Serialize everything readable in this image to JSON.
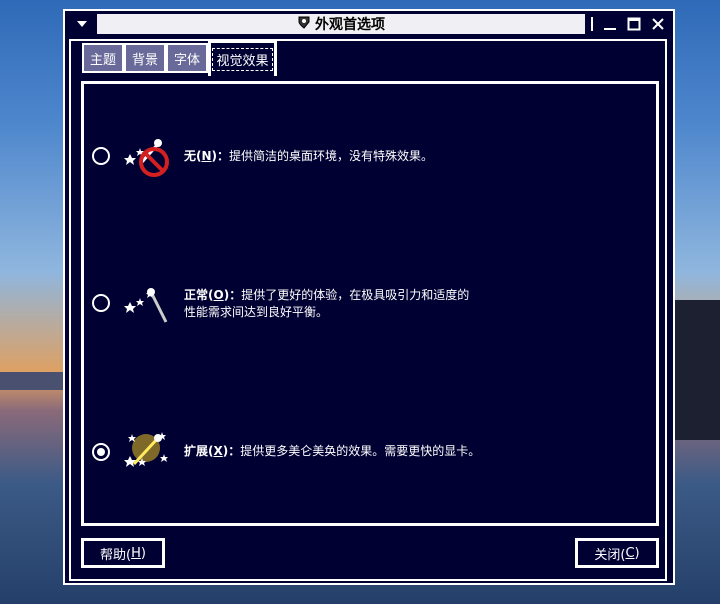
{
  "window": {
    "title": "外观首选项",
    "menu_icon": "triangle-down",
    "controls": [
      "minimize",
      "maximize",
      "close"
    ]
  },
  "tabs": [
    {
      "label": "主题",
      "active": false
    },
    {
      "label": "背景",
      "active": false
    },
    {
      "label": "字体",
      "active": false
    },
    {
      "label": "视觉效果",
      "active": true
    }
  ],
  "options": [
    {
      "name_prefix": "无(",
      "mnemonic": "N",
      "name_suffix": ")：",
      "description": "提供简洁的桌面环境，没有特殊效果。",
      "icon": "no-effects-icon",
      "selected": false
    },
    {
      "name_prefix": "正常(",
      "mnemonic": "O",
      "name_suffix": ")：",
      "description": "提供了更好的体验，在极具吸引力和适度的",
      "description_line2": "性能需求间达到良好平衡。",
      "icon": "normal-effects-icon",
      "selected": false
    },
    {
      "name_prefix": "扩展(",
      "mnemonic": "X",
      "name_suffix": ")：",
      "description": "提供更多美仑美奂的效果。需要更快的显卡。",
      "icon": "extra-effects-icon",
      "selected": true
    }
  ],
  "buttons": {
    "help_prefix": "帮助(",
    "help_mnemonic": "H",
    "help_suffix": ")",
    "close_prefix": "关闭(",
    "close_mnemonic": "C",
    "close_suffix": ")"
  },
  "colors": {
    "window_bg": "#000033",
    "border": "#ffffff",
    "inactive_tab": "#6a6a9a"
  }
}
